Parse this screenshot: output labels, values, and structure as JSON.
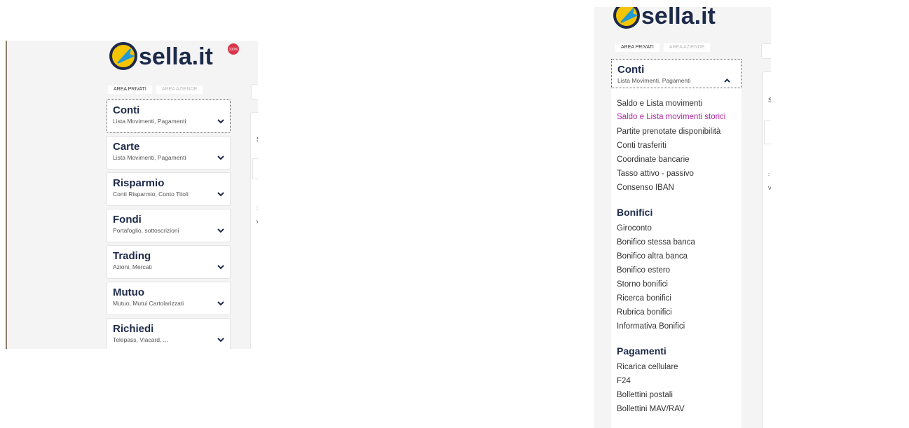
{
  "logo": {
    "text": "sella.it",
    "badge": "100%"
  },
  "area_tabs": {
    "privati": "AREA PRIVATI",
    "aziende": "AREA AZIENDE"
  },
  "left_menu": [
    {
      "title": "Conti",
      "sub": "Lista Movimenti, Pagamenti"
    },
    {
      "title": "Carte",
      "sub": "Lista Movimenti, Pagamenti"
    },
    {
      "title": "Risparmio",
      "sub": "Conti Risparmio, Conto Titoli"
    },
    {
      "title": "Fondi",
      "sub": "Portafoglio, sottoscrizioni"
    },
    {
      "title": "Trading",
      "sub": "Azioni, Mercati"
    },
    {
      "title": "Mutuo",
      "sub": "Mutuo, Mutui Cartolarizzati"
    },
    {
      "title": "Richiedi",
      "sub": "Telepass, Viacard, ..."
    }
  ],
  "fragments": {
    "s": "S",
    "colon": ":",
    "v": "V"
  },
  "expanded": {
    "title": "Conti",
    "sub": "Lista Movimenti, Pagamenti",
    "conti_links": [
      "Saldo e Lista movimenti",
      "Saldo e Lista movimenti storici",
      "Partite prenotate disponibilità",
      "Conti trasferiti",
      "Coordinate bancarie",
      "Tasso attivo - passivo",
      "Consenso IBAN"
    ],
    "bonifici_title": "Bonifici",
    "bonifici_links": [
      "Giroconto",
      "Bonifico stessa banca",
      "Bonifico altra banca",
      "Bonifico estero",
      "Storno bonifici",
      "Ricerca bonifici",
      "Rubrica bonifici",
      "Informativa Bonifici"
    ],
    "pagamenti_title": "Pagamenti",
    "pagamenti_links": [
      "Ricarica cellulare",
      "F24",
      "Bollettini postali",
      "Bollettini MAV/RAV"
    ]
  },
  "colors": {
    "brand_navy": "#1d2a4a",
    "highlight_link": "#b02aa2",
    "logo_yellow": "#f5c400",
    "logo_blue": "#1f9ad6",
    "badge_red": "#d9354a"
  },
  "icons": {
    "logo": "sella-logo-icon",
    "chevron_down": "chevron-down-icon",
    "chevron_up": "chevron-up-icon"
  }
}
